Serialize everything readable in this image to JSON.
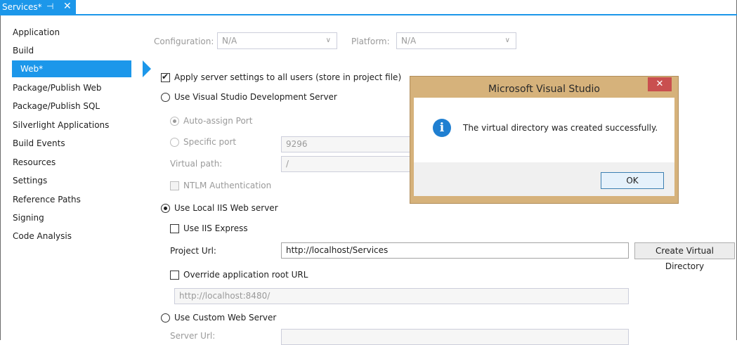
{
  "tab": {
    "title": "Services*",
    "pin": "⊣",
    "close": "✕"
  },
  "sidebar": {
    "items": [
      {
        "label": "Application"
      },
      {
        "label": "Build"
      },
      {
        "label": "Web*"
      },
      {
        "label": "Package/Publish Web"
      },
      {
        "label": "Package/Publish SQL"
      },
      {
        "label": "Silverlight Applications"
      },
      {
        "label": "Build Events"
      },
      {
        "label": "Resources"
      },
      {
        "label": "Settings"
      },
      {
        "label": "Reference Paths"
      },
      {
        "label": "Signing"
      },
      {
        "label": "Code Analysis"
      }
    ],
    "active_index": 2
  },
  "config": {
    "configuration_label": "Configuration:",
    "configuration_value": "N/A",
    "platform_label": "Platform:",
    "platform_value": "N/A"
  },
  "web": {
    "apply_all_label": "Apply server settings to all users (store in project file)",
    "apply_all_checked": true,
    "vs_dev_server_label": "Use Visual Studio Development Server",
    "auto_assign_label": "Auto-assign Port",
    "specific_port_label": "Specific port",
    "specific_port_value": "9296",
    "virtual_path_label": "Virtual path:",
    "virtual_path_value": "/",
    "ntlm_label": "NTLM Authentication",
    "local_iis_label": "Use Local IIS Web server",
    "iis_express_label": "Use IIS Express",
    "project_url_label": "Project Url:",
    "project_url_value": "http://localhost/Services",
    "create_vdir_label": "Create Virtual Directory",
    "override_root_label": "Override application root URL",
    "override_root_value": "http://localhost:8480/",
    "custom_server_label": "Use Custom Web Server",
    "server_url_label": "Server Url:"
  },
  "dialog": {
    "title": "Microsoft Visual Studio",
    "close": "✕",
    "icon": "info-icon",
    "icon_glyph": "i",
    "message": "The virtual directory was created successfully.",
    "ok_label": "OK"
  },
  "colors": {
    "accent": "#1c97ea",
    "dialog_frame": "#d6b27b",
    "close_red": "#c94f4f",
    "info_blue": "#1f7fd1"
  }
}
